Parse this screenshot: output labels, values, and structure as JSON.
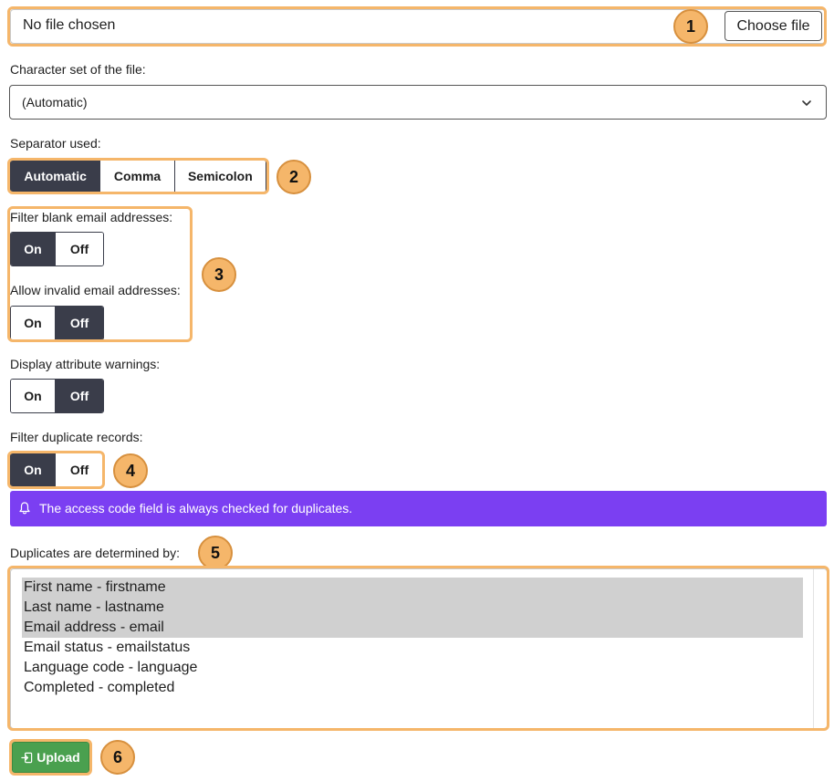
{
  "file": {
    "status": "No file chosen",
    "button_label": "Choose file"
  },
  "charset": {
    "label": "Character set of the file:",
    "value": "(Automatic)"
  },
  "separator": {
    "label": "Separator used:",
    "options": [
      "Automatic",
      "Comma",
      "Semicolon"
    ],
    "selected": "Automatic"
  },
  "filter_blank": {
    "label": "Filter blank email addresses:",
    "on": "On",
    "off": "Off",
    "selected": "On"
  },
  "allow_invalid": {
    "label": "Allow invalid email addresses:",
    "on": "On",
    "off": "Off",
    "selected": "Off"
  },
  "attribute_warnings": {
    "label": "Display attribute warnings:",
    "on": "On",
    "off": "Off",
    "selected": "Off"
  },
  "filter_duplicates": {
    "label": "Filter duplicate records:",
    "on": "On",
    "off": "Off",
    "selected": "On"
  },
  "alert": {
    "text": "The access code field is always checked for duplicates.",
    "color": "#7b3ff2"
  },
  "duplicates": {
    "label": "Duplicates are determined by:",
    "items": [
      {
        "text": "First name - firstname",
        "selected": true
      },
      {
        "text": "Last name - lastname",
        "selected": true
      },
      {
        "text": "Email address - email",
        "selected": true
      },
      {
        "text": "Email status - emailstatus",
        "selected": false
      },
      {
        "text": "Language code - language",
        "selected": false
      },
      {
        "text": "Completed - completed",
        "selected": false
      }
    ]
  },
  "upload": {
    "label": "Upload",
    "icon": "upload-icon",
    "color": "#4aa04f"
  },
  "annotations": [
    "1",
    "2",
    "3",
    "4",
    "5",
    "6"
  ],
  "colors": {
    "highlight": "#f5b66a",
    "active_toggle": "#3a3d4a"
  }
}
